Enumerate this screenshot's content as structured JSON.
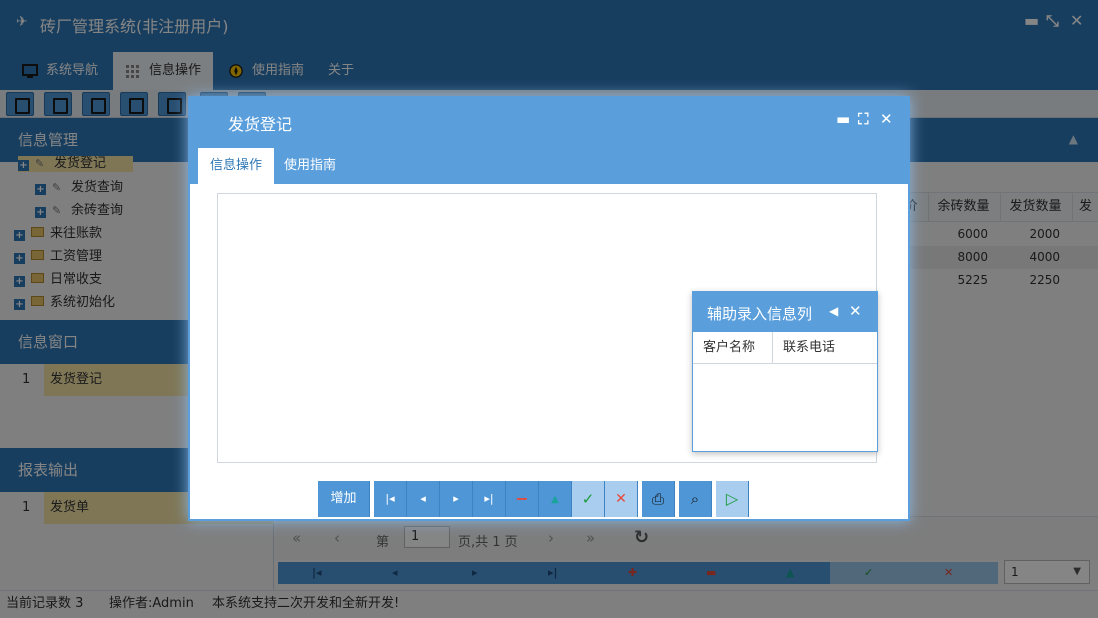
{
  "app": {
    "title": "砖厂管理系统(非注册用户)",
    "window_controls": {
      "minimize": "▬",
      "restore": "⤡",
      "close": "✕"
    }
  },
  "menu": {
    "tabs": [
      {
        "label": "系统导航",
        "icon": "monitor-icon"
      },
      {
        "label": "信息操作",
        "icon": "grid-icon",
        "active": true
      },
      {
        "label": "使用指南",
        "icon": "compass-icon"
      },
      {
        "label": "关于",
        "icon": ""
      }
    ]
  },
  "sidebar": {
    "info_title": "信息管理",
    "tree": [
      {
        "label": "发货登记",
        "type": "tool",
        "selected": true
      },
      {
        "label": "发货查询",
        "type": "tool"
      },
      {
        "label": "余砖查询",
        "type": "tool"
      },
      {
        "label": "来往账款",
        "type": "folder"
      },
      {
        "label": "工资管理",
        "type": "folder"
      },
      {
        "label": "日常收支",
        "type": "folder"
      },
      {
        "label": "系统初始化",
        "type": "folder"
      }
    ],
    "window_title": "信息窗口",
    "window_items": [
      {
        "num": "1",
        "label": "发货登记"
      }
    ],
    "report_title": "报表输出",
    "report_items": [
      {
        "num": "1",
        "label": "发货单"
      }
    ]
  },
  "grid": {
    "columns": [
      "价",
      "余砖数量",
      "发货数量",
      "发"
    ],
    "rows": [
      [
        "6000",
        "2000"
      ],
      [
        "8000",
        "4000"
      ],
      [
        "5225",
        "2250"
      ]
    ]
  },
  "pager": {
    "page_prefix": "第",
    "page_value": "1",
    "page_suffix": "页,共 1 页",
    "page_size": "1"
  },
  "status": {
    "records": "当前记录数 3",
    "operator": "操作者:Admin",
    "notice": "本系统支持二次开发和全新开发!"
  },
  "dialog": {
    "title": "发货登记",
    "tabs": [
      {
        "label": "信息操作",
        "active": true
      },
      {
        "label": "使用指南"
      }
    ],
    "add_label": "增加",
    "helper": {
      "title": "辅助录入信息列",
      "columns": [
        "客户名称",
        "联系电话"
      ]
    }
  },
  "colors": {
    "header_blue": "#2f77b6",
    "dialog_blue": "#5a9fdc",
    "button_blue": "#4e96d6",
    "selected_row": "#f3e2a6"
  }
}
